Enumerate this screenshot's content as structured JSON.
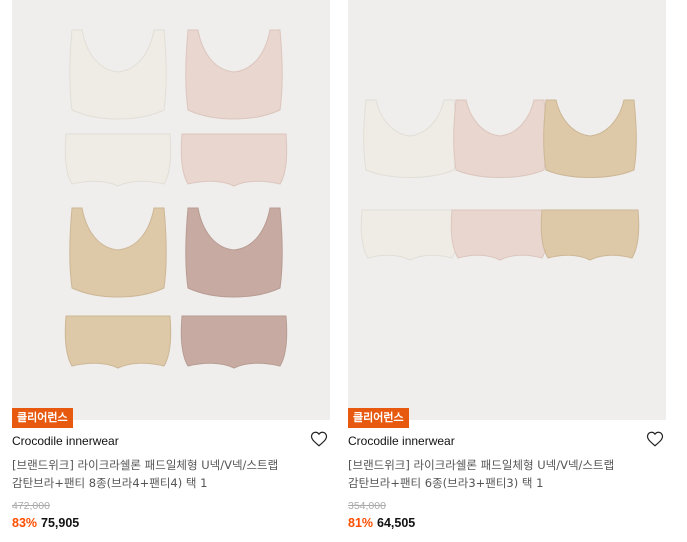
{
  "products": [
    {
      "badge": "클리어런스",
      "brand": "Crocodile innerwear",
      "title_line1": "[브랜드위크] 라이크라쉘론 패드일체형 U넥/V넥/스트랩",
      "title_line2": "감탄브라+팬티 8종(브라4+팬티4) 택 1",
      "original_price": "472,000",
      "discount": "83%",
      "price": "75,905",
      "image_desc": "4 bras and 4 panties in white, pink, beige, mauve"
    },
    {
      "badge": "클리어런스",
      "brand": "Crocodile innerwear",
      "title_line1": "[브랜드위크] 라이크라쉘론 패드일체형 U넥/V넥/스트랩",
      "title_line2": "감탄브라+팬티 6종(브라3+팬티3) 택 1",
      "original_price": "354,000",
      "discount": "81%",
      "price": "64,505",
      "image_desc": "3 bras and 3 panties in white, pink, beige"
    }
  ],
  "colors": {
    "badge_bg": "#e7590f",
    "discount": "#ff4d00",
    "white_garment": "#efece6",
    "pink_garment": "#e8d6cf",
    "beige_garment": "#ddc8a8",
    "mauve_garment": "#c7aba2"
  }
}
